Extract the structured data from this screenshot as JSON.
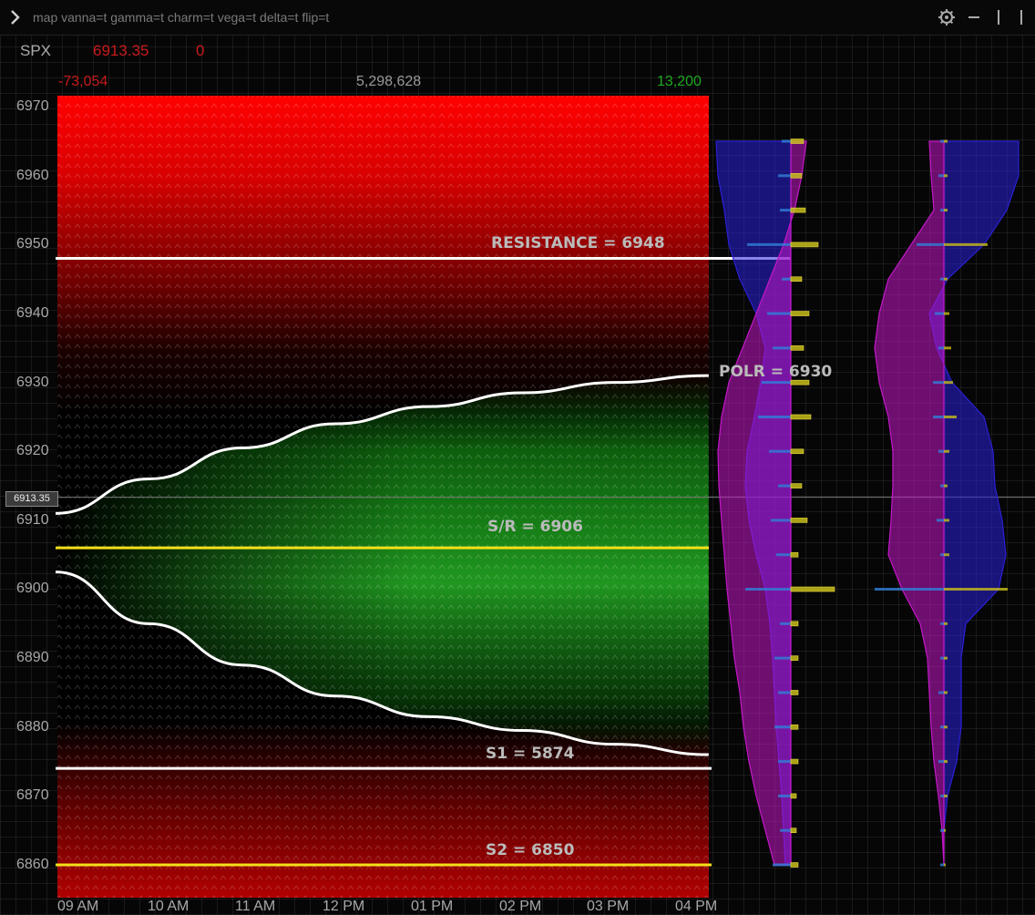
{
  "toolbar": {
    "command": "map vanna=t gamma=t charm=t vega=t delta=t flip=t",
    "icons": [
      "chevron-right-icon",
      "gear-icon",
      "minimize-icon",
      "pin-icon",
      "close-icon"
    ]
  },
  "quote": {
    "symbol": "SPX",
    "price": "6913.35",
    "change": "0"
  },
  "stats": {
    "left": "-73,054",
    "center": "5,298,628",
    "right": "13,200"
  },
  "colors": {
    "negative": "#c81a1a",
    "positive": "#1fa81f",
    "support": "#f3e01a",
    "line": "#ffffff",
    "profile_blue": "#2a20d8",
    "profile_magenta": "#c418c8"
  },
  "chart_data": {
    "type": "heatmap",
    "y_ticks": [
      "6970",
      "6960",
      "6950",
      "6940",
      "6930",
      "6920",
      "6910",
      "6900",
      "6890",
      "6880",
      "6870",
      "6860"
    ],
    "x_ticks": [
      "09 AM",
      "10 AM",
      "11 AM",
      "12 PM",
      "01 PM",
      "02 PM",
      "03 PM",
      "04 PM"
    ],
    "ylim": [
      6855,
      6971
    ],
    "current_price_tag": "6913.35",
    "levels": [
      {
        "label": "RESISTANCE = 6948",
        "value": 6948,
        "color": "#ffffff"
      },
      {
        "label": "POLR = 6930",
        "value": 6930,
        "color": "#ffffff"
      },
      {
        "label": "S/R = 6906",
        "value": 6906,
        "color": "#f3e01a"
      },
      {
        "label": "S1 = 5874",
        "value": 6874,
        "color": "#ffffff"
      },
      {
        "label": "S2 = 6850",
        "value": 6860,
        "color": "#f3e01a"
      }
    ],
    "upper_curve": [
      [
        0,
        6911
      ],
      [
        1,
        6916
      ],
      [
        2,
        6920.5
      ],
      [
        3,
        6924
      ],
      [
        4,
        6926.5
      ],
      [
        5,
        6928.5
      ],
      [
        6,
        6930
      ],
      [
        7,
        6931
      ]
    ],
    "lower_curve": [
      [
        0,
        6902.5
      ],
      [
        1,
        6895
      ],
      [
        2,
        6889
      ],
      [
        3,
        6884.5
      ],
      [
        4,
        6881.5
      ],
      [
        5,
        6879.5
      ],
      [
        6,
        6877.5
      ],
      [
        7,
        6876
      ]
    ],
    "strikes": [
      6965,
      6960,
      6955,
      6950,
      6945,
      6940,
      6935,
      6930,
      6925,
      6920,
      6915,
      6910,
      6905,
      6900,
      6895,
      6890,
      6885,
      6880,
      6875,
      6870,
      6865,
      6860
    ]
  }
}
